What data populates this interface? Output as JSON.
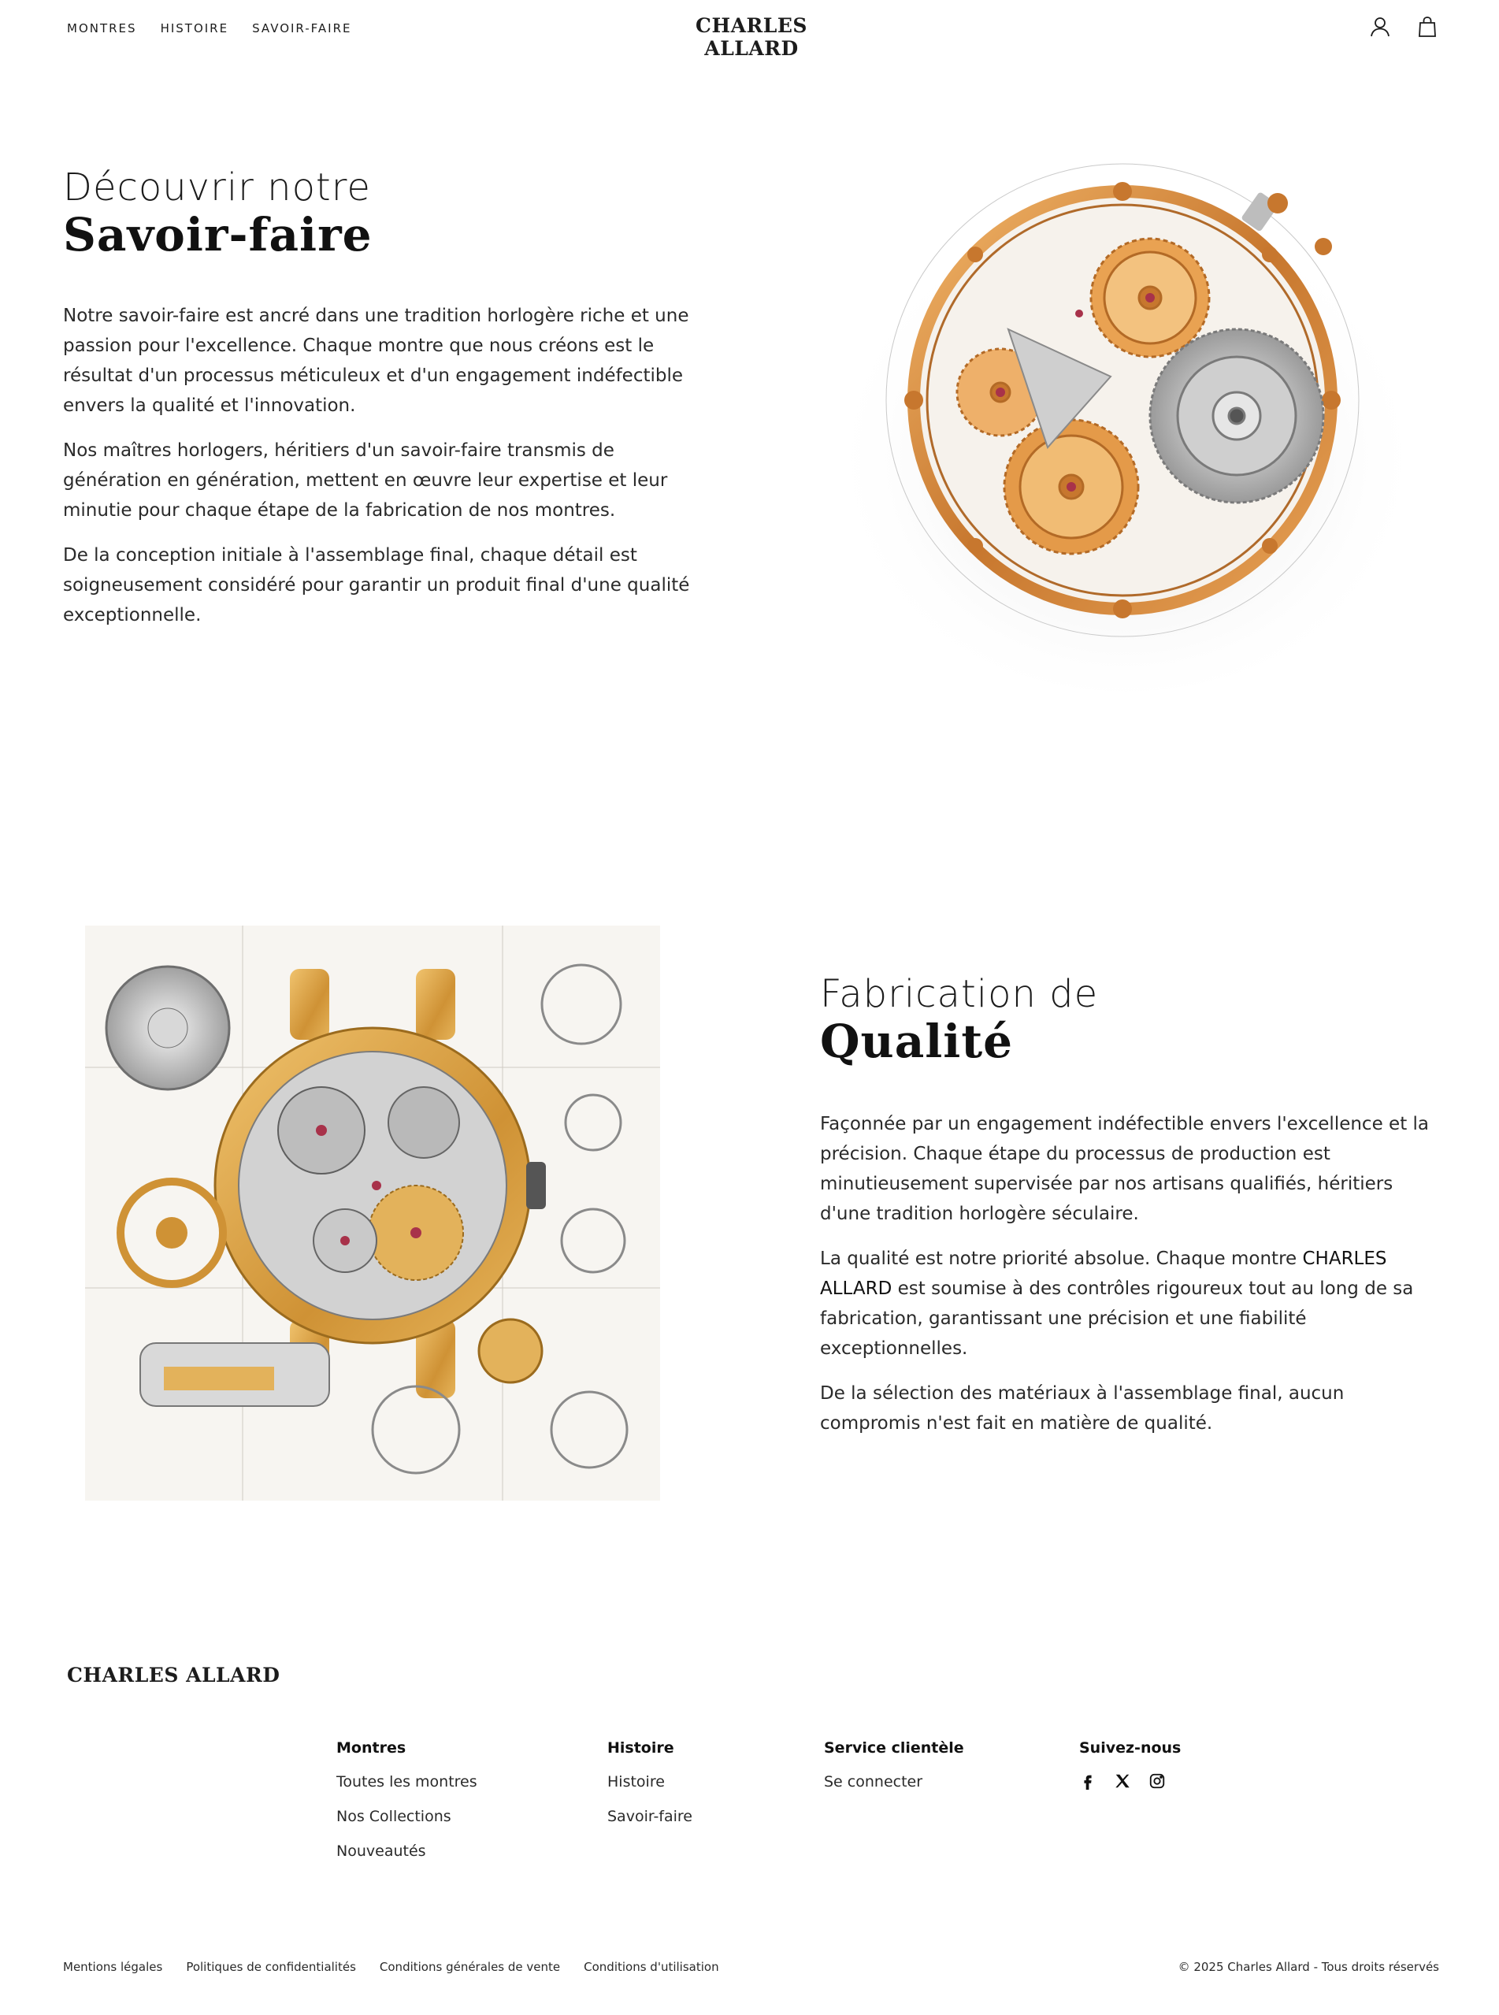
{
  "header": {
    "nav": [
      "MONTRES",
      "HISTOIRE",
      "SAVOIR-FAIRE"
    ],
    "brand": "CHARLES ALLARD",
    "icons": [
      "user-icon",
      "bag-icon"
    ]
  },
  "section1": {
    "heading_light": "Découvrir notre",
    "heading_serif": "Savoir-faire",
    "paragraphs": [
      "Notre savoir-faire est ancré dans une tradition horlogère riche et une passion pour l'excellence. Chaque montre que nous créons est le résultat d'un processus méticuleux et d'un engagement indéfectible envers la qualité et l'innovation.",
      "Nos maîtres horlogers, héritiers d'un savoir-faire transmis de génération en génération, mettent en œuvre leur expertise et leur minutie pour chaque étape de la fabrication de nos montres.",
      "De la conception initiale à l'assemblage final, chaque détail est soigneusement considéré pour garantir un produit final d'une qualité exceptionnelle."
    ]
  },
  "section2": {
    "heading_light": "Fabrication de",
    "heading_serif": "Qualité",
    "p1": "Façonnée par un engagement indéfectible envers l'excellence et la précision. Chaque étape du processus de production est minutieusement supervisée par nos artisans qualifiés, héritiers d'une tradition horlogère séculaire.",
    "p2_before": "La qualité est notre priorité absolue. Chaque montre ",
    "p2_brand": "CHARLES ALLARD",
    "p2_after": " est soumise à des contrôles rigoureux tout au long de sa fabrication, garantissant une précision et une fiabilité exceptionnelles.",
    "p3": "De la sélection des matériaux à l'assemblage final, aucun compromis n'est fait en matière de qualité."
  },
  "footer": {
    "brand": "CHARLES ALLARD",
    "columns": [
      {
        "title": "Montres",
        "links": [
          "Toutes les montres",
          "Nos Collections",
          "Nouveautés"
        ]
      },
      {
        "title": "Histoire",
        "links": [
          "Histoire",
          "Savoir-faire"
        ]
      },
      {
        "title": "Service clientèle",
        "links": [
          "Se connecter"
        ]
      },
      {
        "title": "Suivez-nous",
        "social": [
          "facebook-icon",
          "x-icon",
          "instagram-icon"
        ]
      }
    ],
    "legal": [
      "Mentions légales",
      "Politiques de confidentialités",
      "Conditions générales de vente",
      "Conditions d'utilisation"
    ],
    "copyright": "© 2025 Charles Allard - Tous droits réservés"
  },
  "colors": {
    "text": "#1c1c1c",
    "gold": "#c98a3a",
    "background": "#ffffff"
  }
}
